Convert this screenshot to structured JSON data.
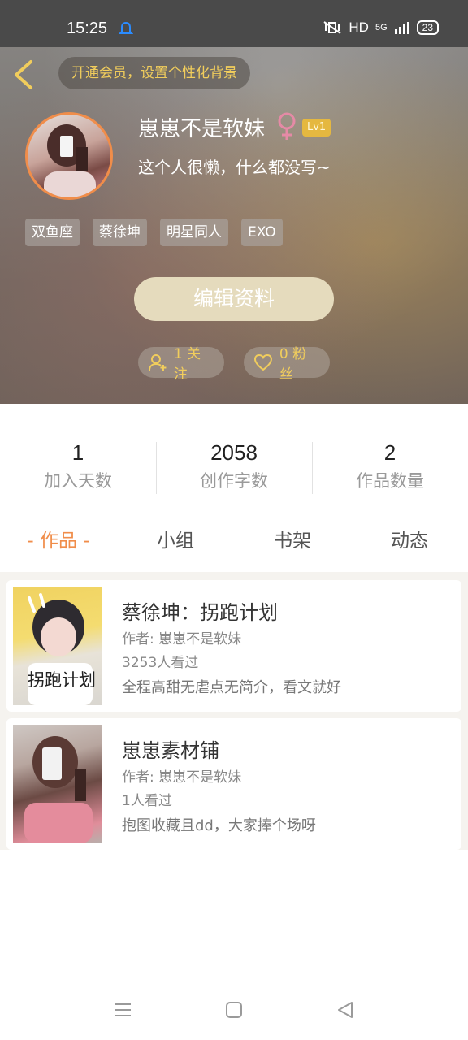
{
  "status": {
    "time": "15:25",
    "network": "HD",
    "signal": "5G",
    "battery": "23"
  },
  "header": {
    "vip_prompt": "开通会员，设置个性化背景",
    "username": "崽崽不是软妹",
    "level": "Lv1",
    "bio": "这个人很懒，什么都没写~",
    "tags": [
      "双鱼座",
      "蔡徐坤",
      "明星同人",
      "EXO"
    ],
    "edit_label": "编辑资料",
    "follow_label": "1 关注",
    "fans_label": "0 粉丝"
  },
  "stats": [
    {
      "value": "1",
      "label": "加入天数"
    },
    {
      "value": "2058",
      "label": "创作字数"
    },
    {
      "value": "2",
      "label": "作品数量"
    }
  ],
  "tabs": [
    "- 作品 -",
    "小组",
    "书架",
    "动态"
  ],
  "works": [
    {
      "title": "蔡徐坤：拐跑计划",
      "author": "作者: 崽崽不是软妹",
      "views": "3253人看过",
      "desc": "全程高甜无虐点无简介，看文就好",
      "cover_text": "拐跑计划"
    },
    {
      "title": "崽崽素材铺",
      "author": "作者: 崽崽不是软妹",
      "views": "1人看过",
      "desc": "抱图收藏且dd，大家捧个场呀"
    }
  ],
  "colors": {
    "accent": "#f08d4a",
    "gold": "#f1cd5c",
    "edit_button": "#e5dbbd"
  }
}
